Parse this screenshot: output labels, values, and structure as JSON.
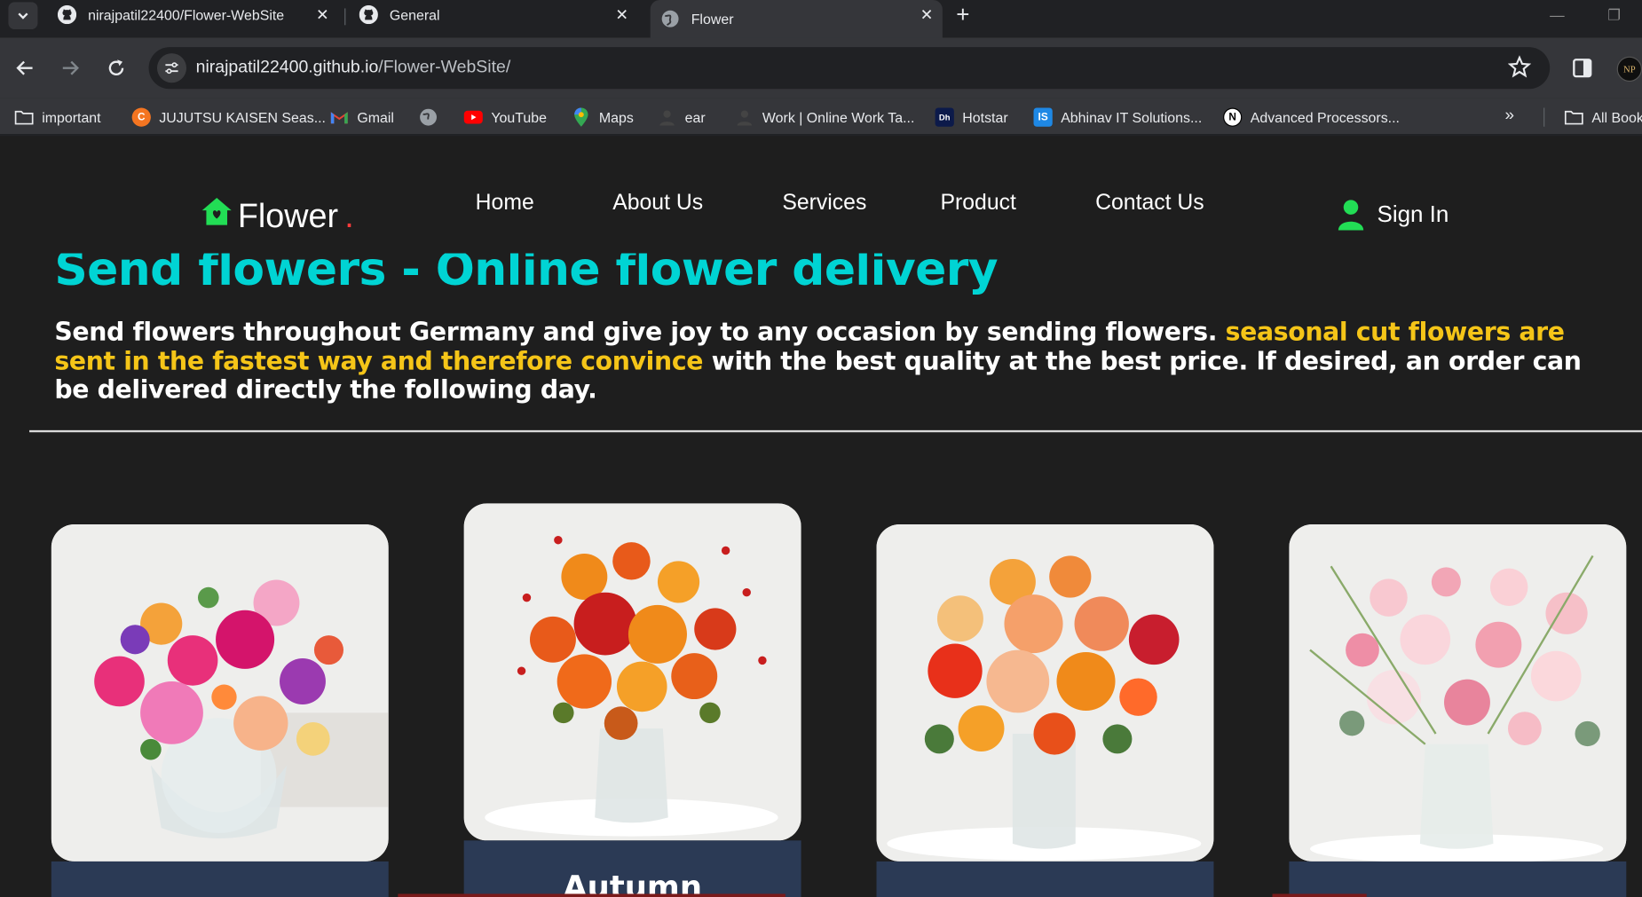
{
  "browser": {
    "tabs": [
      {
        "title": "nirajpatil22400/Flower-WebSite",
        "icon": "github-icon"
      },
      {
        "title": "General",
        "icon": "github-icon"
      },
      {
        "title": "Flower",
        "icon": "globe-icon",
        "active": true
      }
    ],
    "url_host": "nirajpatil22400.github.io",
    "url_path": "/Flower-WebSite/",
    "profile_initials": "NP",
    "bookmarks": [
      {
        "label": "important",
        "icon": "folder-icon"
      },
      {
        "label": "JUJUTSU KAISEN Seas...",
        "icon": "crunchyroll-icon"
      },
      {
        "label": "Gmail",
        "icon": "gmail-icon"
      },
      {
        "label": "",
        "icon": "globe-icon"
      },
      {
        "label": "YouTube",
        "icon": "youtube-icon"
      },
      {
        "label": "Maps",
        "icon": "maps-icon"
      },
      {
        "label": "ear",
        "icon": "person-icon"
      },
      {
        "label": "Work | Online Work Ta...",
        "icon": "person-icon"
      },
      {
        "label": "Hotstar",
        "icon": "hotstar-icon"
      },
      {
        "label": "Abhinav IT Solutions...",
        "icon": "is-icon"
      },
      {
        "label": "Advanced Processors...",
        "icon": "notion-icon"
      }
    ],
    "all_bookmarks": "All Bookmarks"
  },
  "site": {
    "logo_text": "Flower",
    "logo_dot": ".",
    "nav": [
      "Home",
      "About Us",
      "Services",
      "Product",
      "Contact Us"
    ],
    "signin": "Sign In",
    "hero_title": "Send flowers - Online flower delivery",
    "desc_part1": "Send flowers throughout Germany and give joy to any occasion by sending flowers. ",
    "desc_highlight": "seasonal cut flowers are sent in the fastest way and therefore convince",
    "desc_part2": " with the best quality at the best price. If desired, an order can be delivered directly the following day.",
    "cards": [
      {
        "caption": "",
        "image": "mixed-pink-bouquet"
      },
      {
        "caption": "Autumn",
        "image": "autumn-orange-bouquet"
      },
      {
        "caption": "",
        "image": "orange-red-bouquet"
      },
      {
        "caption": "",
        "image": "pastel-rose-bouquet"
      }
    ],
    "colors": {
      "accent_cyan": "#00d4d4",
      "highlight_yellow": "#f5c518",
      "logo_green": "#22dd55",
      "card_footer": "#2b3a55"
    }
  }
}
